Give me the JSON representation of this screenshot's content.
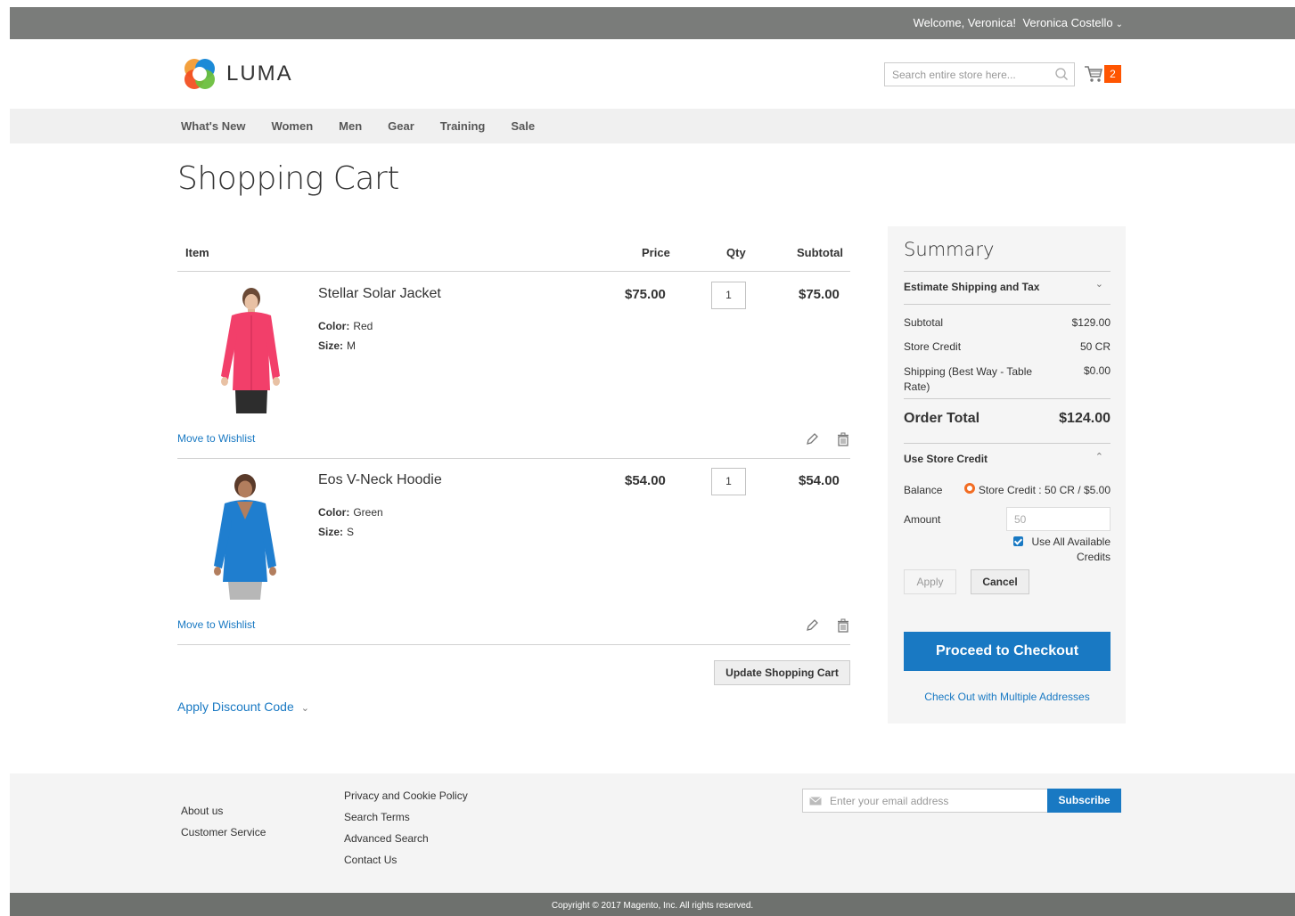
{
  "topbar": {
    "welcome": "Welcome, Veronica!",
    "account_name": "Veronica Costello"
  },
  "header": {
    "brand": "LUMA",
    "search_placeholder": "Search entire store here...",
    "cart_count": "2"
  },
  "nav": {
    "items": [
      "What's New",
      "Women",
      "Men",
      "Gear",
      "Training",
      "Sale"
    ]
  },
  "page": {
    "title": "Shopping Cart"
  },
  "cart": {
    "columns": {
      "item": "Item",
      "price": "Price",
      "qty": "Qty",
      "subtotal": "Subtotal"
    },
    "items": [
      {
        "name": "Stellar Solar Jacket",
        "color_label": "Color:",
        "color": "Red",
        "size_label": "Size:",
        "size": "M",
        "price": "$75.00",
        "qty": "1",
        "subtotal": "$75.00",
        "wishlist": "Move to Wishlist",
        "garment_color": "#f23f6a"
      },
      {
        "name": "Eos V-Neck Hoodie",
        "color_label": "Color:",
        "color": "Green",
        "size_label": "Size:",
        "size": "S",
        "price": "$54.00",
        "qty": "1",
        "subtotal": "$54.00",
        "wishlist": "Move to Wishlist",
        "garment_color": "#1f7ecf"
      }
    ],
    "update_button": "Update Shopping Cart",
    "discount_link": "Apply Discount Code"
  },
  "summary": {
    "title": "Summary",
    "estimate_shipping": "Estimate Shipping and Tax",
    "rows": [
      {
        "label": "Subtotal",
        "value": "$129.00"
      },
      {
        "label": "Store Credit",
        "value": "50 CR"
      },
      {
        "label": "Shipping (Best Way - Table Rate)",
        "value": "$0.00"
      }
    ],
    "order_total_label": "Order Total",
    "order_total_value": "$124.00",
    "store_credit": {
      "heading": "Use Store Credit",
      "balance_label": "Balance",
      "balance_value": "Store Credit : 50 CR / $5.00",
      "amount_label": "Amount",
      "amount_placeholder": "50",
      "use_all_label": "Use All Available Credits",
      "apply_button": "Apply",
      "cancel_button": "Cancel"
    },
    "checkout_button": "Proceed to Checkout",
    "multi_address_link": "Check Out with Multiple Addresses"
  },
  "footer": {
    "col1": [
      "About us",
      "Customer Service"
    ],
    "col2": [
      "Privacy and Cookie Policy",
      "Search Terms",
      "Advanced Search",
      "Contact Us"
    ],
    "email_placeholder": "Enter your email address",
    "subscribe_button": "Subscribe",
    "copyright": "Copyright © 2017 Magento, Inc. All rights reserved."
  },
  "colors": {
    "accent": "#1979c3",
    "cart_badge": "#ff5501",
    "topbar": "#7a7c7a"
  },
  "icons": [
    "chevron-down-icon",
    "luma-logo-icon",
    "search-icon",
    "cart-icon",
    "edit-icon",
    "trash-icon",
    "chevron-up-icon",
    "store-credit-coin-icon",
    "checkbox-checked-icon",
    "envelope-icon"
  ]
}
